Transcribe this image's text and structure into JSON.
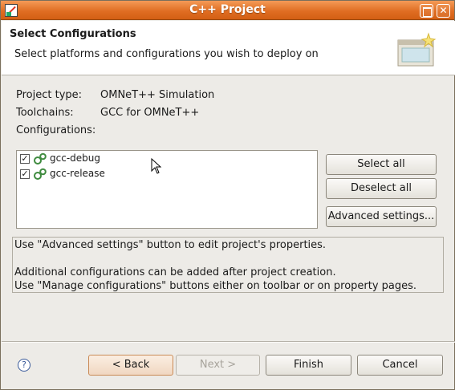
{
  "window": {
    "title": "C++ Project"
  },
  "banner": {
    "heading": "Select Configurations",
    "subheading": "Select platforms and configurations you wish to deploy on"
  },
  "info": {
    "project_type_label": "Project type:",
    "project_type_value": "OMNeT++ Simulation",
    "toolchains_label": "Toolchains:",
    "toolchains_value": "GCC for OMNeT++",
    "configurations_label": "Configurations:"
  },
  "configurations": [
    {
      "name": "gcc-debug",
      "checked": true,
      "icon": "gear-icon"
    },
    {
      "name": "gcc-release",
      "checked": true,
      "icon": "gear-icon"
    }
  ],
  "buttons": {
    "select_all": "Select all",
    "deselect_all": "Deselect all",
    "advanced_settings": "Advanced settings..."
  },
  "messages": {
    "line1": "Use \"Advanced settings\" button to edit project's properties.",
    "line2": "Additional configurations can be added after project creation.",
    "line3": "Use \"Manage configurations\" buttons either on toolbar or on property pages."
  },
  "footer": {
    "back": "< Back",
    "next": "Next >",
    "finish": "Finish",
    "cancel": "Cancel",
    "help_icon": "help-icon"
  },
  "colors": {
    "titlebar": "#e06e23",
    "background": "#edebe7"
  }
}
